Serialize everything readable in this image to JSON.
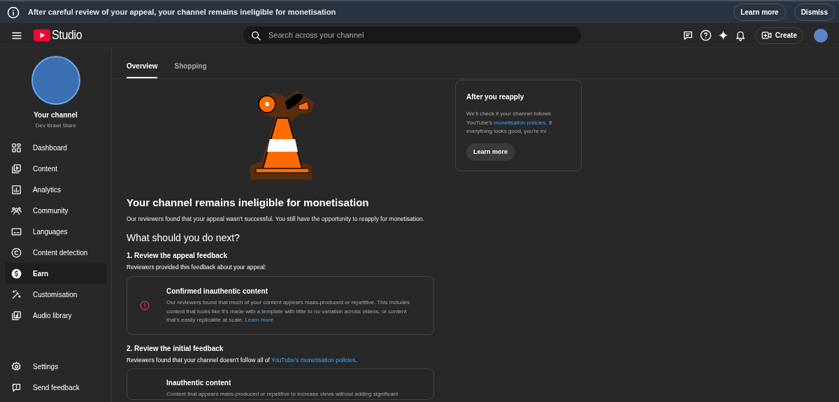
{
  "banner": {
    "message": "After careful review of your appeal, your channel remains ineligible for monetisation",
    "buttons": [
      "Learn more",
      "Dismiss"
    ]
  },
  "header": {
    "logo_text": "Studio",
    "search": {
      "placeholder": "Search across your channel"
    },
    "create_label": "Create"
  },
  "sidebar": {
    "channel_title": "Your channel",
    "channel_name": "Dev Brawl Stars",
    "items": [
      {
        "label": "Dashboard",
        "selected": false
      },
      {
        "label": "Content",
        "selected": false
      },
      {
        "label": "Analytics",
        "selected": false
      },
      {
        "label": "Community",
        "selected": false
      },
      {
        "label": "Languages",
        "selected": false
      },
      {
        "label": "Content detection",
        "selected": false
      },
      {
        "label": "Earn",
        "selected": true
      },
      {
        "label": "Customisation",
        "selected": false
      },
      {
        "label": "Audio library",
        "selected": false
      }
    ],
    "footer_items": [
      {
        "label": "Settings"
      },
      {
        "label": "Send feedback"
      }
    ]
  },
  "tabs": [
    {
      "label": "Overview",
      "selected": true
    },
    {
      "label": "Shopping",
      "selected": false
    }
  ],
  "main": {
    "title": "Your channel remains ineligible for monetisation",
    "subtitle": "Our reviewers found that your appeal wasn't successful. You still have the opportunity to reapply for monetisation.",
    "next_heading": "What should you do next?",
    "steps": [
      {
        "heading": "1. Review the appeal feedback",
        "intro": "Reviewers provided this feedback about your appeal:",
        "card": {
          "title": "Confirmed inauthentic content",
          "body": "Our reviewers found that much of your content appears mass-produced or repetitive. This includes content that looks like it's made with a template with little to no variation across videos, or content that's easily replicable at scale.",
          "link": "Learn more",
          "alert": true
        }
      },
      {
        "heading": "2. Review the initial feedback",
        "intro": "Reviewers found that your channel doesn't follow all of",
        "intro_link": "YouTube's monetisation policies",
        "intro_end": ".",
        "card": {
          "title": "Inauthentic content",
          "body": "Content that appears mass-produced or repetitive to increase views without adding significant",
          "alert": false
        }
      }
    ]
  },
  "reapply_card": {
    "title": "After you reapply",
    "text_before": "We'll check if your channel follows YouTube's",
    "link": "monetisation policies",
    "text_after": ". If everything looks good, you're in!",
    "button": "Learn more"
  }
}
